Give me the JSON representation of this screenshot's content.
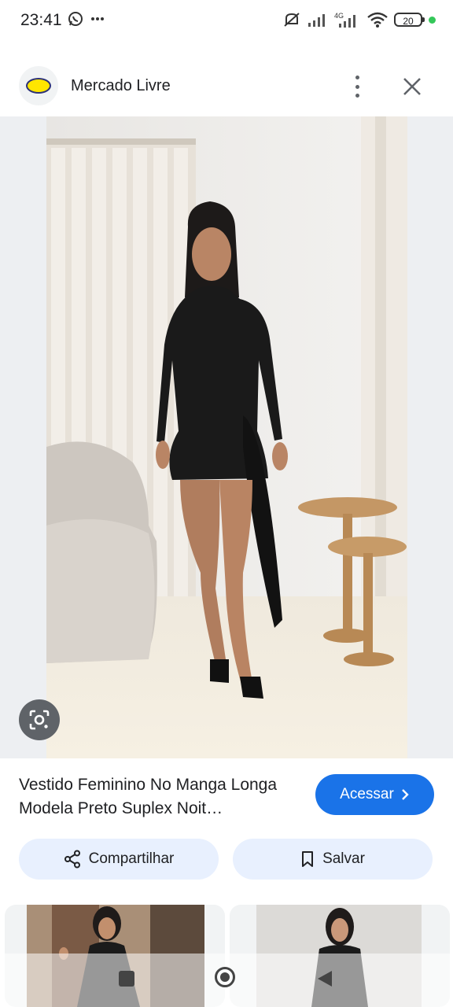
{
  "status_bar": {
    "time": "23:41",
    "battery": "20",
    "icons": [
      "whatsapp-icon",
      "more-notifications-icon",
      "mute-icon",
      "signal-icon",
      "signal-4g-icon",
      "wifi-icon",
      "battery-icon"
    ]
  },
  "header": {
    "site_name": "Mercado Livre",
    "logo": "mercado-livre-handshake-logo",
    "more_icon": "more-vert-icon",
    "close_icon": "close-icon"
  },
  "image": {
    "lens_icon": "google-lens-icon"
  },
  "product": {
    "title": "Vestido Feminino No Manga Longa Modela Preto Suplex Noit…",
    "visit_label": "Acessar",
    "visit_icon": "chevron-right-icon"
  },
  "actions": {
    "share_label": "Compartilhar",
    "save_label": "Salvar"
  },
  "colors": {
    "accent": "#1a73e8",
    "chip_bg": "#e8f0fe"
  }
}
